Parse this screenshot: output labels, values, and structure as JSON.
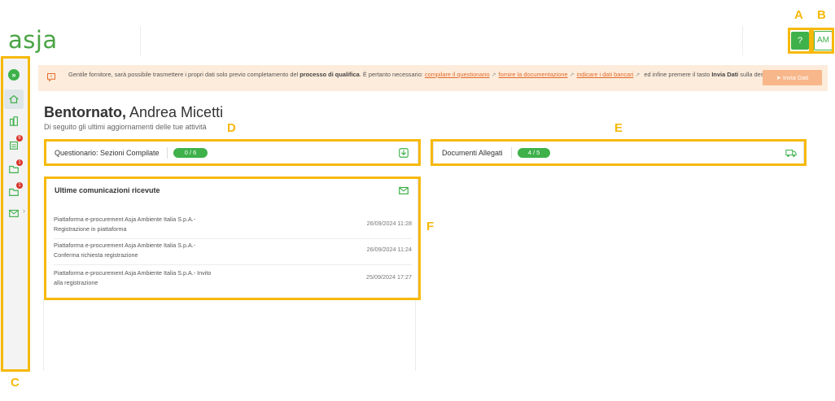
{
  "header": {
    "logo": "asja",
    "help_label": "?",
    "avatar_initials": "AM"
  },
  "notice": {
    "text_before": "Gentile fornitore, sarà possibile trasmettere i propri dati solo previo completamento del ",
    "bold_process": "processo di qualifica",
    "text_mid": ". È pertanto necessario: ",
    "link_questionnaire": "compilare il questionario",
    "link_documents": "fornire la documentazione",
    "link_bank": "indicare i dati bancari",
    "text_after": " ed infine premere il tasto ",
    "bold_send": "Invia Dati",
    "text_end": " sulla destra",
    "send_button": "Invia Dati"
  },
  "welcome": {
    "greeting": "Bentornato,",
    "name": "Andrea Micetti",
    "subtitle": "Di seguito gli ultimi aggiornamenti delle tue attività"
  },
  "cards": {
    "questionnaire": {
      "title": "Questionario: Sezioni Compilate",
      "count": "0 / 6"
    },
    "documents": {
      "title": "Documenti Allegati",
      "count": "4 / 5"
    }
  },
  "messages": {
    "title": "Ultime comunicazioni ricevute",
    "items": [
      {
        "line1": "Piattaforma e-procurement Asja Ambiente Italia S.p.A.-",
        "line2": "Registrazione in piattaforma",
        "date": "26/09/2024 11:28"
      },
      {
        "line1": "Piattaforma e-procurement Asja Ambiente Italia S.p.A.-",
        "line2": "Conferma richiesta registrazione",
        "date": "26/09/2024 11:24"
      },
      {
        "line1": "Piattaforma e-procurement Asja Ambiente Italia S.p.A.- Invito",
        "line2": "alla registrazione",
        "date": "25/09/2024 17:27"
      }
    ]
  },
  "sidebar": {
    "expand_icon": "double-chevron-right-icon",
    "items": [
      {
        "icon": "home-icon",
        "badge": ""
      },
      {
        "icon": "buildings-icon",
        "badge": ""
      },
      {
        "icon": "clipboard-icon",
        "badge": "6"
      },
      {
        "icon": "folder-icon",
        "badge": "1"
      },
      {
        "icon": "folder-alt-icon",
        "badge": "1"
      },
      {
        "icon": "mail-icon",
        "badge": ""
      }
    ]
  },
  "annotations": {
    "A": "A",
    "B": "B",
    "C": "C",
    "D": "D",
    "E": "E",
    "F": "F"
  },
  "colors": {
    "brand_green": "#3fb14b",
    "accent_orange": "#e46a2b",
    "notice_bg": "#fdecdb",
    "annotation": "#f6b90a",
    "badge_red": "#d9342b"
  }
}
